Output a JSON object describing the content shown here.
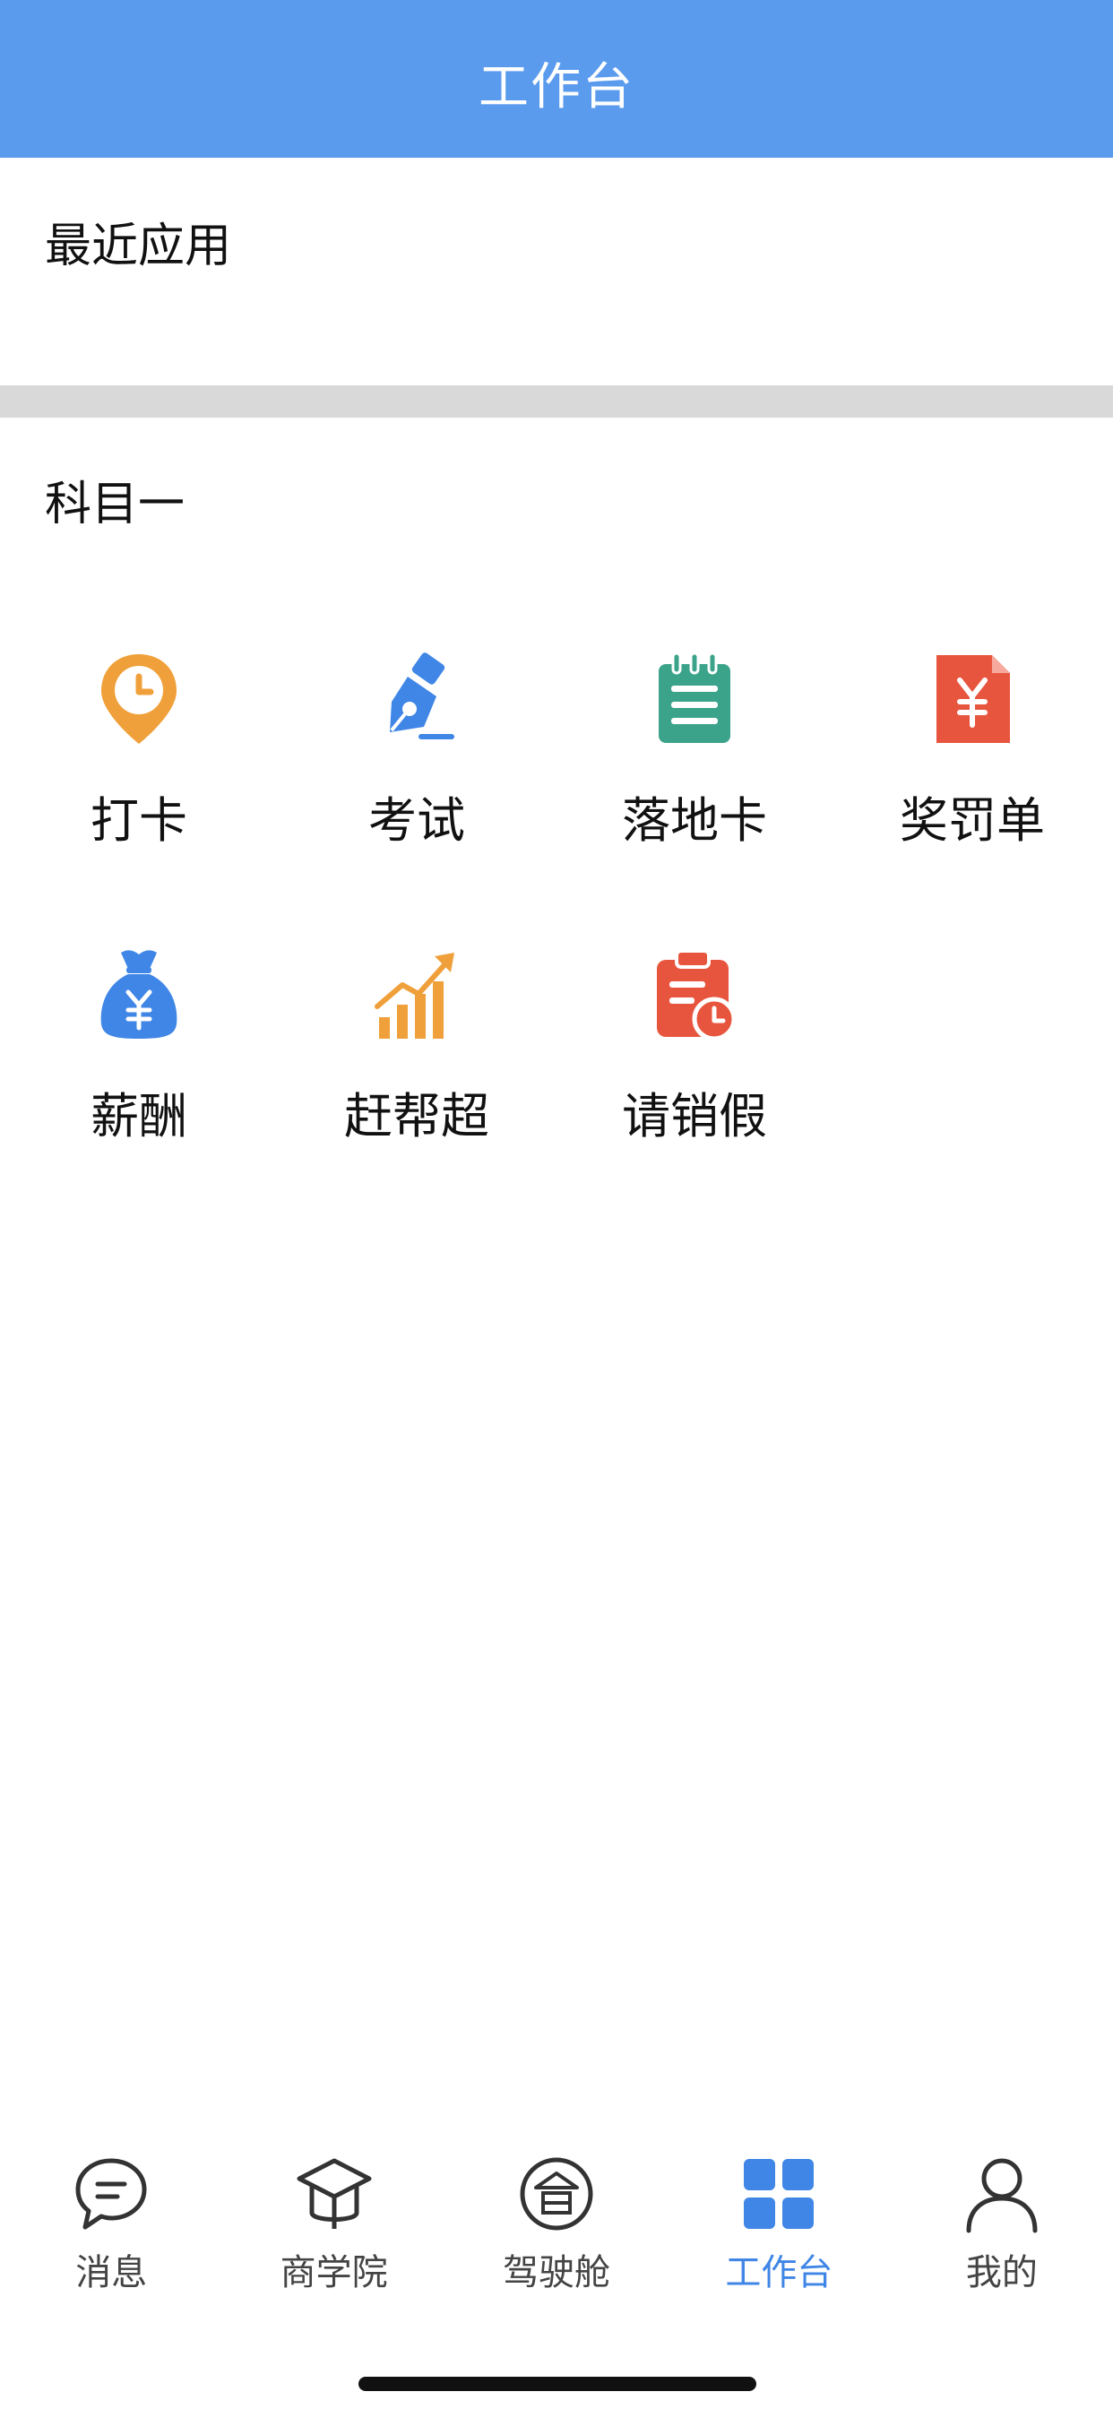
{
  "header": {
    "title": "工作台"
  },
  "recent": {
    "title": "最近应用"
  },
  "subject": {
    "title": "科目一"
  },
  "apps": [
    {
      "label": "打卡",
      "icon": "location-clock-icon",
      "color": "#f0a03a"
    },
    {
      "label": "考试",
      "icon": "pen-nib-icon",
      "color": "#3f86e6"
    },
    {
      "label": "落地卡",
      "icon": "notepad-icon",
      "color": "#3aa38a"
    },
    {
      "label": "奖罚单",
      "icon": "yen-document-icon",
      "color": "#e8553e"
    },
    {
      "label": "薪酬",
      "icon": "money-bag-icon",
      "color": "#3f86e6"
    },
    {
      "label": "赶帮超",
      "icon": "growth-chart-icon",
      "color": "#f0a03a"
    },
    {
      "label": "请销假",
      "icon": "clipboard-clock-icon",
      "color": "#e8553e"
    }
  ],
  "tabbar": {
    "active_color": "#3f86e6",
    "items": [
      {
        "label": "消息",
        "icon": "chat-bubble-icon"
      },
      {
        "label": "商学院",
        "icon": "graduation-cap-icon"
      },
      {
        "label": "驾驶舱",
        "icon": "cockpit-icon"
      },
      {
        "label": "工作台",
        "icon": "grid-icon",
        "active": true
      },
      {
        "label": "我的",
        "icon": "person-icon"
      }
    ]
  }
}
